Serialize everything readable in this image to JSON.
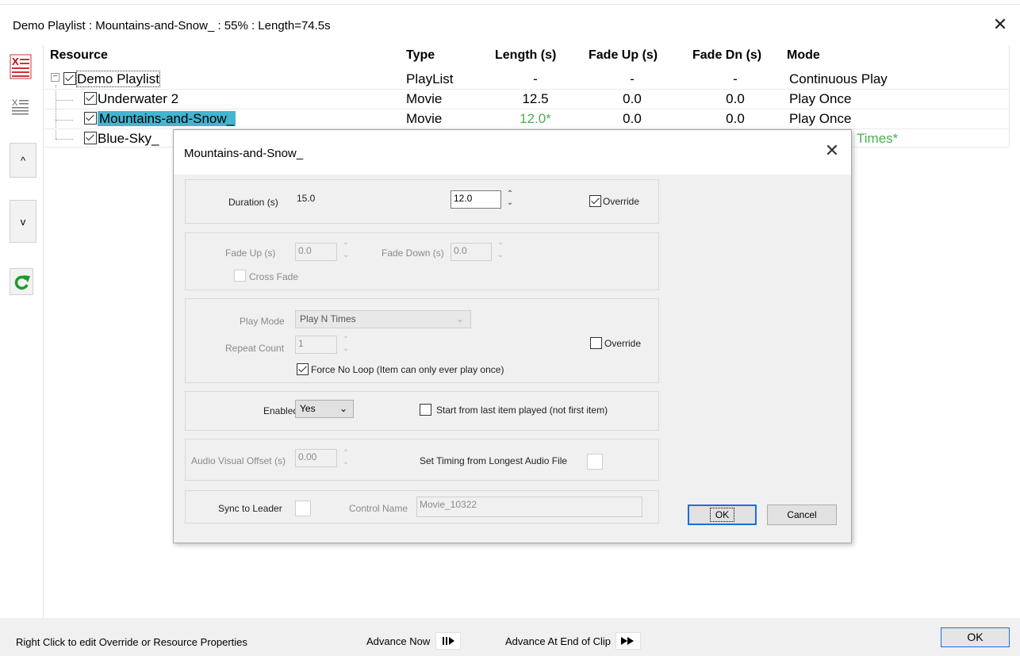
{
  "window": {
    "title": "Demo Playlist : Mountains-and-Snow_ : 55% : Length=74.5s",
    "close_icon": "close-icon"
  },
  "grid": {
    "headers": {
      "resource": "Resource",
      "type": "Type",
      "length": "Length (s)",
      "fade_up": "Fade Up (s)",
      "fade_dn": "Fade Dn (s)",
      "mode": "Mode"
    },
    "rows": [
      {
        "name": "Demo Playlist",
        "type": "PlayList",
        "length": "-",
        "fade_up": "-",
        "fade_dn": "-",
        "mode": "Continuous Play"
      },
      {
        "name": "Underwater 2",
        "type": "Movie",
        "length": "12.5",
        "fade_up": "0.0",
        "fade_dn": "0.0",
        "mode": "Play Once"
      },
      {
        "name": "Mountains-and-Snow_",
        "type": "Movie",
        "length": "12.0*",
        "fade_up": "0.0",
        "fade_dn": "0.0",
        "mode": "Play Once"
      },
      {
        "name": "Blue-Sky_",
        "mode": "Times*"
      }
    ],
    "override_color": "#4caf50",
    "selection_color": "#44b4d0"
  },
  "toolbar": {
    "up_label": "^",
    "down_label": "v"
  },
  "footer": {
    "hint": "Right Click to edit Override or Resource Properties",
    "advance_now": "Advance Now",
    "advance_end": "Advance At End of Clip",
    "ok": "OK"
  },
  "dialog": {
    "title": "Mountains-and-Snow_",
    "duration_label": "Duration (s)",
    "duration_original": "15.0",
    "duration_value": "12.0",
    "override_label": "Override",
    "fade_up_label": "Fade Up (s)",
    "fade_up_value": "0.0",
    "fade_down_label": "Fade Down (s)",
    "fade_down_value": "0.0",
    "cross_fade_label": "Cross Fade",
    "play_mode_label": "Play Mode",
    "play_mode_value": "Play N Times",
    "repeat_count_label": "Repeat Count",
    "repeat_count_value": "1",
    "override2_label": "Override",
    "force_no_loop_label": "Force No Loop (Item can only ever play once)",
    "enabled_label": "Enabled",
    "enabled_value": "Yes",
    "start_from_last_label": "Start from last item played (not first item)",
    "av_offset_label": "Audio Visual Offset (s)",
    "av_offset_value": "0.00",
    "set_timing_label": "Set Timing from Longest Audio File",
    "sync_leader_label": "Sync to Leader",
    "control_name_label": "Control Name",
    "control_name_value": "Movie_10322",
    "ok": "OK",
    "cancel": "Cancel"
  }
}
